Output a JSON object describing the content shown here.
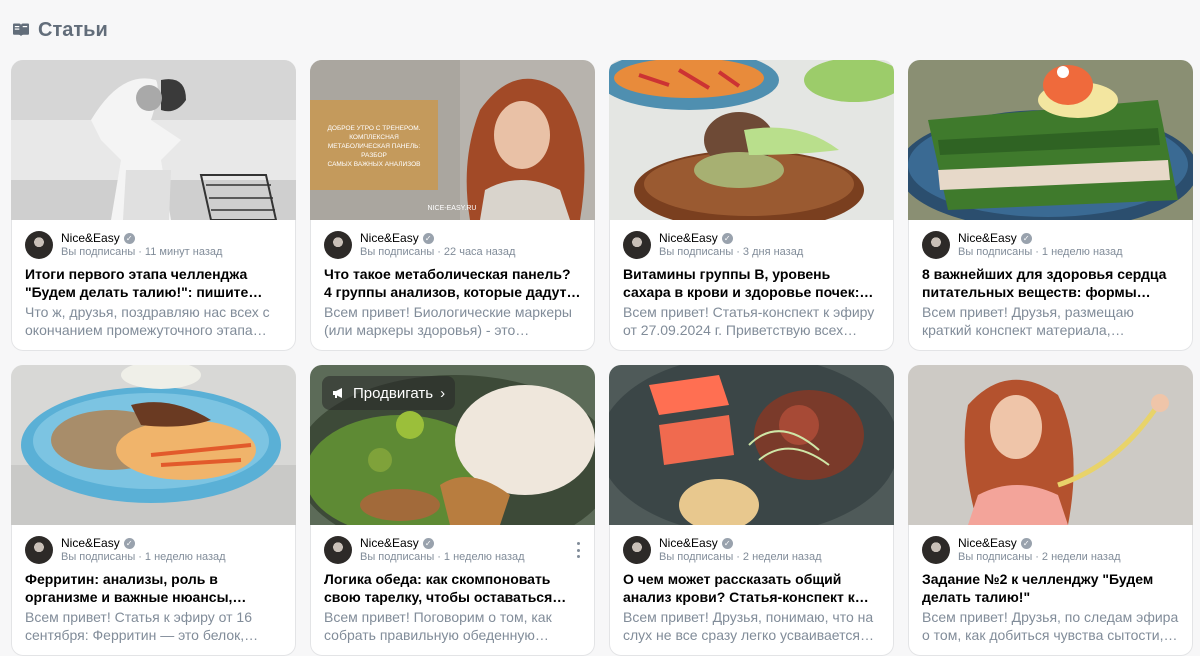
{
  "section": {
    "title": "Статьи",
    "icon": "articles-icon"
  },
  "promote_label": "Продвигать",
  "cards": [
    {
      "author": "Nice&Easy",
      "subscribed": "Вы подписаны",
      "time": "11 минут назад",
      "title": "Итоги первого этапа челленджа \"Будем делать талию!\": пишите…",
      "desc": "Что ж, друзья, поздравляю нас всех с окончанием промежуточного этапа…"
    },
    {
      "author": "Nice&Easy",
      "subscribed": "Вы подписаны",
      "time": "22 часа назад",
      "title": "Что такое метаболическая панель? 4 группы анализов, которые дадут…",
      "desc": "Всем привет! Биологические маркеры (или маркеры здоровья) - это…",
      "image_text": "ДОБРОЕ УТРО С ТРЕНЕРОМ. КОМПЛЕКСНАЯ МЕТАБОЛИЧЕСКАЯ ПАНЕЛЬ: РАЗБОР САМЫХ ВАЖНЫХ АНАЛИЗОВ",
      "image_site": "NICE-EASY.RU"
    },
    {
      "author": "Nice&Easy",
      "subscribed": "Вы подписаны",
      "time": "3 дня назад",
      "title": "Витамины группы В, уровень сахара в крови и здоровье почек:…",
      "desc": "Всем привет! Статья-конспект к эфиру от 27.09.2024 г. Приветствую всех…"
    },
    {
      "author": "Nice&Easy",
      "subscribed": "Вы подписаны",
      "time": "1 неделю назад",
      "title": "8 важнейших для здоровья сердца питательных веществ: формы…",
      "desc": "Всем привет! Друзья, размещаю краткий конспект материала,…"
    },
    {
      "author": "Nice&Easy",
      "subscribed": "Вы подписаны",
      "time": "1 неделю назад",
      "title": "Ферритин: анализы, роль в организме и важные нюансы,…",
      "desc": "Всем привет! Статья к эфиру от 16 сентября: Ферритин — это белок,…"
    },
    {
      "author": "Nice&Easy",
      "subscribed": "Вы подписаны",
      "time": "1 неделю назад",
      "title": "Логика обеда: как скомпоновать свою тарелку, чтобы оставаться…",
      "desc": "Всем привет! Поговорим о том, как собрать правильную обеденную…",
      "promote": true,
      "more": true
    },
    {
      "author": "Nice&Easy",
      "subscribed": "Вы подписаны",
      "time": "2 недели назад",
      "title": "О чем может рассказать общий анализ крови? Статья-конспект к…",
      "desc": "Всем привет! Друзья, понимаю, что на слух не все сразу легко усваивается…"
    },
    {
      "author": "Nice&Easy",
      "subscribed": "Вы подписаны",
      "time": "2 недели назад",
      "title": "Задание №2 к челленджу \"Будем делать талию!\"",
      "desc": "Всем привет! Друзья, по следам эфира о том, как добиться чувства сытости,…"
    }
  ]
}
